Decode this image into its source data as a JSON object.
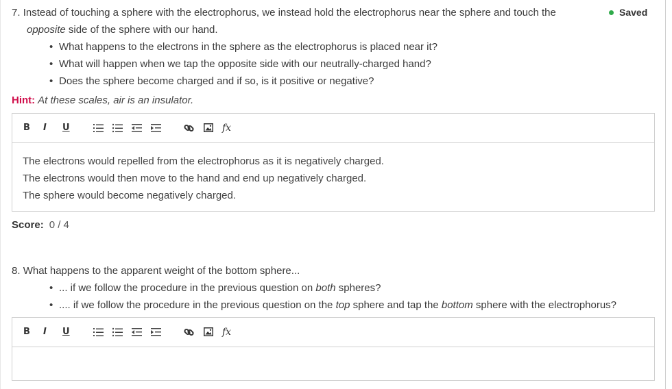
{
  "status": {
    "saved_label": "Saved",
    "color": "#2faa4a"
  },
  "q7": {
    "number": "7.",
    "line1": "Instead of touching a sphere with the electrophorus, we instead hold the electrophorus near the sphere and touch the",
    "line2_emph": "opposite",
    "line2_rest": " side of the sphere with our hand.",
    "bullets": [
      "What happens to the electrons in the sphere as the electrophorus is placed near it?",
      "What will happen when we tap the opposite side with our neutrally-charged hand?",
      "Does the sphere become charged and if so, is it positive or negative?"
    ],
    "hint_label": "Hint:",
    "hint_text": "At these scales, air is an insulator.",
    "answer": [
      "The electrons would repelled from the electrophorus as it is negatively charged.",
      "The electrons would then move to the hand and end up negatively charged.",
      "The sphere would become negatively charged."
    ],
    "score_label": "Score:",
    "score_value": "0 / 4"
  },
  "q8": {
    "number": "8.",
    "text": "What happens to the apparent weight of the bottom sphere...",
    "bullet1_a": "... if we follow the procedure in the previous question on ",
    "bullet1_em": "both",
    "bullet1_b": " spheres?",
    "bullet2_a": ".... if we follow the procedure in the previous question on the ",
    "bullet2_em1": "top",
    "bullet2_b": " sphere and tap the ",
    "bullet2_em2": "bottom",
    "bullet2_c": " sphere with the electrophorus?"
  },
  "toolbar": {
    "bold": "B",
    "italic": "I",
    "underline": "U",
    "formula": "fx"
  },
  "bullet_char": "•",
  "accent": "#d0104c"
}
